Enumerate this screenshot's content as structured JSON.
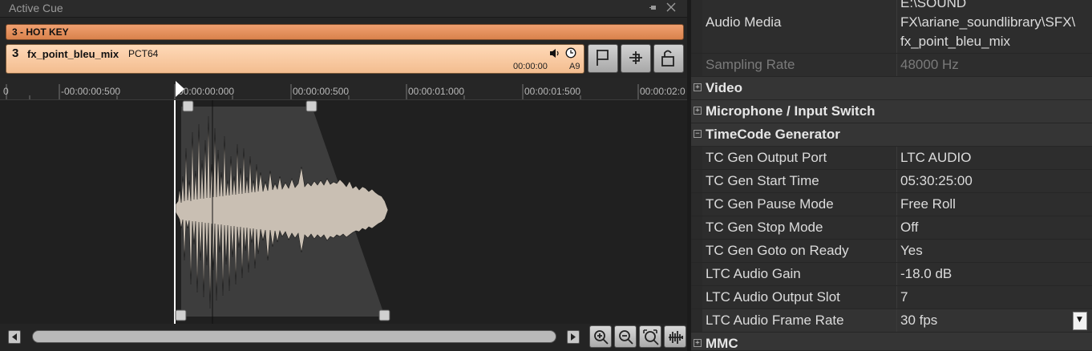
{
  "panel": {
    "title": "Active Cue"
  },
  "hotkey": {
    "label": "3 - HOT KEY"
  },
  "cue": {
    "number": "3",
    "name": "fx_point_bleu_mix",
    "device": "PCT64",
    "time": "00:00:00",
    "slot": "A9"
  },
  "ruler": {
    "ticks": [
      "0",
      "-00:00:00:500",
      "00:00:00:000",
      "00:00:00:500",
      "00:00:01:000",
      "00:00:01:500",
      "00:00:02:0"
    ]
  },
  "properties": {
    "audio_media_label": "Audio Media",
    "audio_media_value_lines": [
      "E:\\SOUND",
      "FX\\ariane_soundlibrary\\SFX\\",
      "fx_point_bleu_mix"
    ],
    "sampling_rate_label": "Sampling Rate",
    "sampling_rate_value": "48000 Hz",
    "categories": {
      "video": "Video",
      "microphone": "Microphone / Input Switch",
      "timecode": "TimeCode Generator",
      "mmc": "MMC"
    },
    "tc_rows": [
      {
        "label": "TC Gen Output Port",
        "value": "LTC AUDIO"
      },
      {
        "label": "TC Gen Start Time",
        "value": "05:30:25:00"
      },
      {
        "label": "TC Gen Pause Mode",
        "value": "Free Roll"
      },
      {
        "label": "TC Gen Stop Mode",
        "value": "Off"
      },
      {
        "label": "TC Gen Goto on Ready",
        "value": "Yes"
      },
      {
        "label": "LTC Audio Gain",
        "value": "-18.0 dB"
      },
      {
        "label": "LTC Audio Output Slot",
        "value": "7"
      },
      {
        "label": "LTC Audio Frame Rate",
        "value": "30 fps"
      }
    ],
    "expand_symbol": "+",
    "collapse_symbol": "−"
  },
  "colors": {
    "hotkey": "#e8935a",
    "cue_row": "#f7c9a0",
    "waveform": "#c9bfb3",
    "envelope": "#3d3d3d"
  }
}
